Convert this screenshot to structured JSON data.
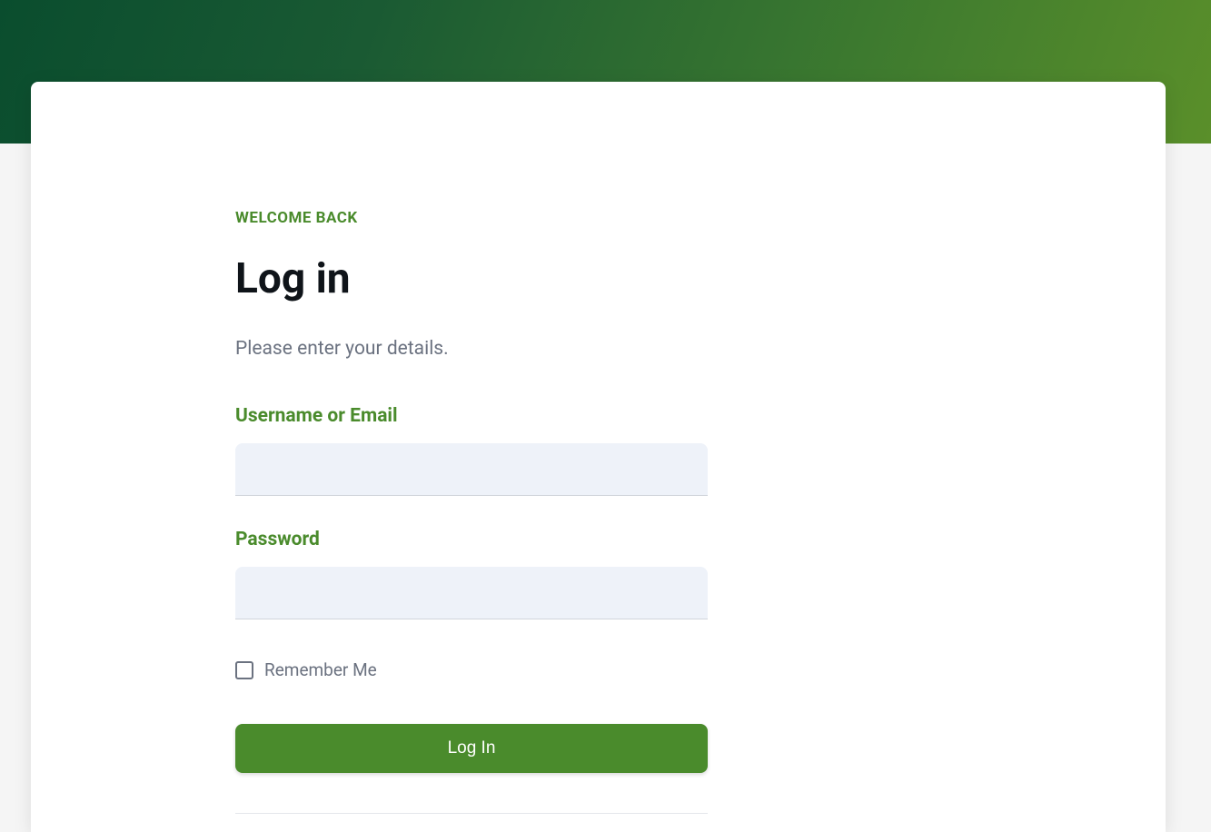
{
  "header": {
    "eyebrow": "WELCOME BACK",
    "title": "Log in",
    "subtitle": "Please enter your details."
  },
  "form": {
    "username": {
      "label": "Username or Email",
      "value": ""
    },
    "password": {
      "label": "Password",
      "value": ""
    },
    "remember": {
      "label": "Remember Me",
      "checked": false
    },
    "submit": {
      "label": "Log In"
    }
  },
  "colors": {
    "accent": "#4a8b2c",
    "header_gradient_start": "#0a4d2e",
    "header_gradient_end": "#5a8f2a"
  }
}
